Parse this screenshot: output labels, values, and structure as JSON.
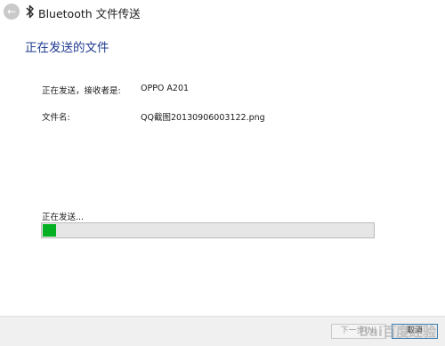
{
  "window": {
    "title": "Bluetooth 文件传送",
    "back_icon": "back-arrow-icon",
    "bluetooth_icon": "bluetooth-icon"
  },
  "page": {
    "heading": "正在发送的文件"
  },
  "details": {
    "recipient_label": "正在发送，接收者是:",
    "recipient_value": "OPPO A201",
    "filename_label": "文件名:",
    "filename_value": "QQ截图20130906003122.png"
  },
  "progress": {
    "status_label": "正在发送...",
    "percent": 4,
    "color": "#06b025"
  },
  "footer": {
    "next_label": "下一步(N)",
    "cancel_label": "取消"
  },
  "watermark": {
    "text": "Bai百度经验"
  }
}
